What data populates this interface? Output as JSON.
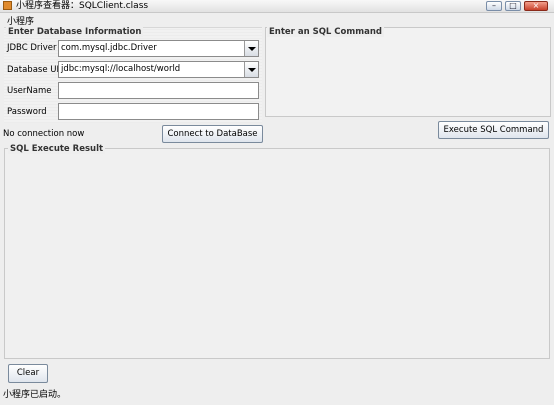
{
  "window": {
    "title": "小程序查看器：SQLClient.class",
    "controls": {
      "minimize": "–",
      "maximize": "□",
      "close": "×"
    }
  },
  "menu_label": "小程序",
  "db_panel": {
    "legend": "Enter Database Information",
    "jdbc_driver_label": "JDBC Driver",
    "jdbc_driver_value": "com.mysql.jdbc.Driver",
    "database_url_label": "Database URL",
    "database_url_value": "jdbc:mysql://localhost/world",
    "username_label": "UserName",
    "username_value": "",
    "password_label": "Password",
    "password_value": ""
  },
  "command_panel": {
    "legend": "Enter an SQL Command",
    "command_text": ""
  },
  "status_text": "No connection now",
  "connect_button": "Connect to DataBase",
  "execute_button": "Execute SQL Command",
  "result_panel": {
    "legend": "SQL Execute Result",
    "result_text": ""
  },
  "clear_button": "Clear",
  "footer_status": "小程序已启动。"
}
